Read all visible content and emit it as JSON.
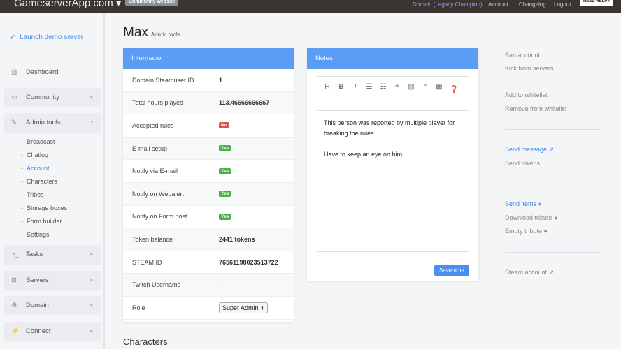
{
  "topbar": {
    "brand": "GameserverApp.com",
    "community": "Community website",
    "links": [
      "Domain (Legacy Champion)",
      "Account",
      "Changelog",
      "Logout"
    ],
    "help": "NEED HELP?"
  },
  "sidebar": {
    "launch": "Launch demo server",
    "items": [
      {
        "label": "Dashboard"
      },
      {
        "label": "Community"
      },
      {
        "label": "Admin tools"
      }
    ],
    "sub": [
      "Broadcast",
      "Chatlog",
      "Account",
      "Characters",
      "Tribes",
      "Storage boxes",
      "Form builder",
      "Settings"
    ],
    "bottom": [
      "Tasks",
      "Servers",
      "Domain",
      "Connect"
    ]
  },
  "page": {
    "title": "Max",
    "subtitle": "Admin tools"
  },
  "info": {
    "title": "Information",
    "rows": [
      {
        "k": "Domain Steamuser ID",
        "v": "1"
      },
      {
        "k": "Total hours played",
        "v": "113.46666666667"
      },
      {
        "k": "Accepted rules",
        "badge": "No"
      },
      {
        "k": "E-mail setup",
        "badge": "Yes"
      },
      {
        "k": "Notify via E-mail",
        "badge": "Yes"
      },
      {
        "k": "Notify on Webalert",
        "badge": "Yes"
      },
      {
        "k": "Notify on Form post",
        "badge": "Yes"
      },
      {
        "k": "Token balance",
        "v": "2441 tokens"
      },
      {
        "k": "STEAM ID",
        "v": "76561198023513722"
      },
      {
        "k": "Twitch Username",
        "v": "-"
      },
      {
        "k": "Role",
        "select": "Super Admin"
      }
    ]
  },
  "notes": {
    "title": "Notes",
    "line1": "This person was reported by multiple player for breaking the rules.",
    "line2": "Have to keep an eye on him.",
    "save": "Save note"
  },
  "actions": {
    "ban": "Ban account",
    "kick": "Kick from servers",
    "add_wl": "Add to whitelist",
    "rm_wl": "Remove from whitelist",
    "send_msg": "Send message",
    "send_tokens": "Send tokens",
    "send_items": "Send items",
    "download": "Download tribute",
    "empty": "Empty tribute",
    "steam": "Steam account"
  },
  "characters": {
    "title": "Characters"
  }
}
